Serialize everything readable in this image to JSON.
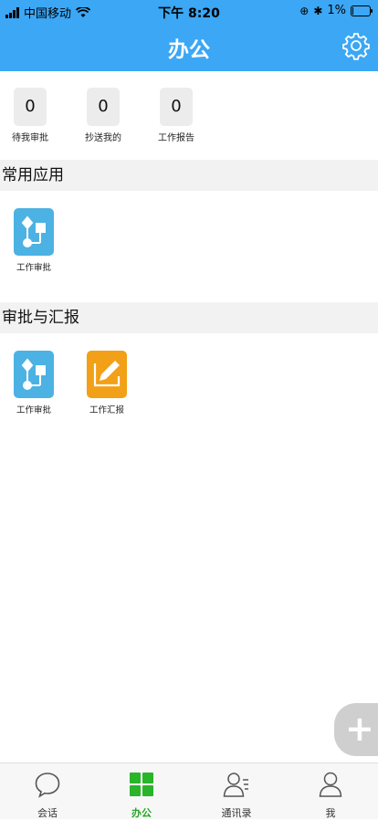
{
  "status_bar": {
    "carrier": "中国移动",
    "time": "下午 8:20",
    "battery": "1%"
  },
  "header": {
    "title": "办公",
    "settings_icon": "gear-icon"
  },
  "stats": [
    {
      "count": "0",
      "label": "待我审批"
    },
    {
      "count": "0",
      "label": "抄送我的"
    },
    {
      "count": "0",
      "label": "工作报告"
    }
  ],
  "sections": {
    "common": {
      "title": "常用应用",
      "apps": [
        {
          "label": "工作审批",
          "icon": "flowchart-icon",
          "color": "#4cb2e3"
        }
      ]
    },
    "approval_report": {
      "title": "审批与汇报",
      "apps": [
        {
          "label": "工作审批",
          "icon": "flowchart-icon",
          "color": "#4cb2e3"
        },
        {
          "label": "工作汇报",
          "icon": "edit-icon",
          "color": "#f2a017"
        }
      ]
    }
  },
  "fab": {
    "label": "+"
  },
  "tabs": [
    {
      "label": "会话",
      "icon": "chat-icon"
    },
    {
      "label": "办公",
      "icon": "grid-icon",
      "active": true
    },
    {
      "label": "通讯录",
      "icon": "contacts-icon"
    },
    {
      "label": "我",
      "icon": "person-icon"
    }
  ],
  "colors": {
    "primary": "#3ba7f5",
    "active_tab": "#29a329",
    "app_blue": "#4cb2e3",
    "app_orange": "#f2a017"
  }
}
